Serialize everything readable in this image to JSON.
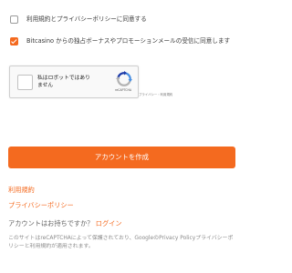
{
  "consent": {
    "terms_label": "利用規約とプライバシーポリシーに同意する",
    "terms_checked": false,
    "bonus_label": "Bitcasino からの独占ボーナスやプロモーションメールの受信に同意します",
    "bonus_checked": true
  },
  "recaptcha": {
    "checkbox_label": "私はロボットではありません",
    "brand": "reCAPTCHA",
    "links": "プライバシー・利用規約"
  },
  "actions": {
    "create_account_label": "アカウントを作成",
    "terms_link": "利用規約",
    "privacy_link": "プライバシーポリシー",
    "have_account_text": "アカウントはお持ちですか？",
    "login_link": "ログイン"
  },
  "disclaimer": "このサイトはreCAPTCHAによって保護されており、GoogleのPrivacy Policyプライバシーポリシーと利用規約が適用されます。",
  "colors": {
    "accent": "#f46a1f",
    "recaptcha_blue": "#4a90e2",
    "recaptcha_dark_blue": "#1c3aa9",
    "recaptcha_gray": "#b3b3b3"
  },
  "icons": {
    "recaptcha_logo": "recaptcha-logo-icon",
    "checkmark": "checkmark-icon"
  }
}
